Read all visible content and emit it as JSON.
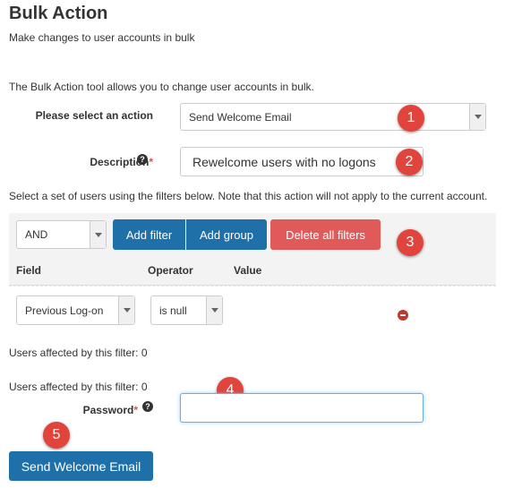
{
  "page": {
    "title": "Bulk Action",
    "subtitle": "Make changes to user accounts in bulk",
    "intro": "The Bulk Action tool allows you to change user accounts in bulk."
  },
  "action": {
    "label": "Please select an action",
    "value": "Send Welcome Email"
  },
  "description": {
    "label": "Description",
    "required_mark": "*",
    "help_icon": "?",
    "value": "Rewelcome users with no logons"
  },
  "filter_note": "Select a set of users using the filters below. Note that this action will not apply to the current account.",
  "filters": {
    "logic_value": "AND",
    "add_filter_label": "Add filter",
    "add_group_label": "Add group",
    "delete_all_label": "Delete all filters",
    "columns": [
      "Field",
      "Operator",
      "Value"
    ],
    "row": {
      "field": "Previous Log-on",
      "operator": "is null"
    },
    "row_affected": "Users affected by this filter: 0",
    "total_affected": "Users affected by this filter: 0"
  },
  "password": {
    "label": "Password",
    "required_mark": "*",
    "help_icon": "?",
    "value": ""
  },
  "submit_label": "Send Welcome Email",
  "badges": [
    "1",
    "2",
    "3",
    "4",
    "5"
  ],
  "colors": {
    "primary": "#1f6fa8",
    "danger": "#e05a5a",
    "badge": "#e0443c",
    "focus_border": "#66afe9"
  }
}
